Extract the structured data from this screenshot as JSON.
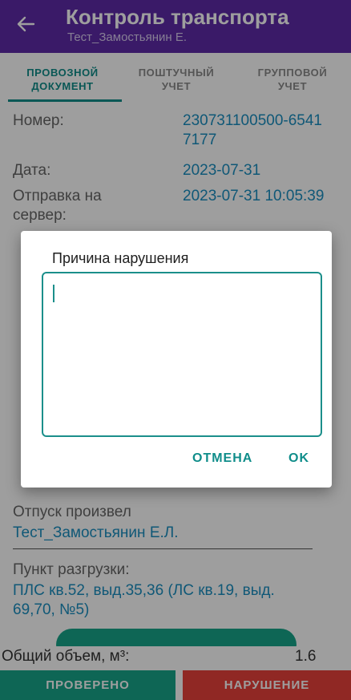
{
  "appbar": {
    "title": "Контроль транспорта",
    "subtitle": "Тест_Замостьянин Е.",
    "back_icon": "arrow-left-icon"
  },
  "tabs": [
    {
      "line1": "ПРОВОЗНОЙ",
      "line2": "ДОКУМЕНТ",
      "active": true
    },
    {
      "line1": "ПОШТУЧНЫЙ",
      "line2": "УЧЕТ",
      "active": false
    },
    {
      "line1": "ГРУППОВОЙ",
      "line2": "УЧЕТ",
      "active": false
    }
  ],
  "document": {
    "number_label": "Номер:",
    "number_value_line1": "230731100500-6541",
    "number_value_line2": "7177",
    "date_label": "Дата:",
    "date_value": "2023-07-31",
    "send_label_line1": "Отправка на",
    "send_label_line2": "сервер:",
    "send_value": "2023-07-31 10:05:39",
    "released_by_label": "Отпуск произвел",
    "released_by_value": "Тест_Замостьянин Е.Л.",
    "unload_point_label": "Пункт разгрузки:",
    "unload_point_line1": "ПЛС кв.52, выд.35,36 (ЛС кв.19, выд.",
    "unload_point_line2": "69,70, №5)"
  },
  "totals": {
    "volume_label": "Общий объем, м³:",
    "volume_value": "1.6"
  },
  "actions": {
    "checked": "ПРОВЕРЕНО",
    "violation": "НАРУШЕНИЕ"
  },
  "dialog": {
    "title": "Причина нарушения",
    "input_value": "",
    "cancel": "ОТМЕНА",
    "ok": "OK"
  },
  "colors": {
    "appbar": "#5e2ba8",
    "accent": "#0f8d8a",
    "link_value": "#1a8fc0",
    "checked_button": "#17a589",
    "violation_button": "#e8413b"
  }
}
